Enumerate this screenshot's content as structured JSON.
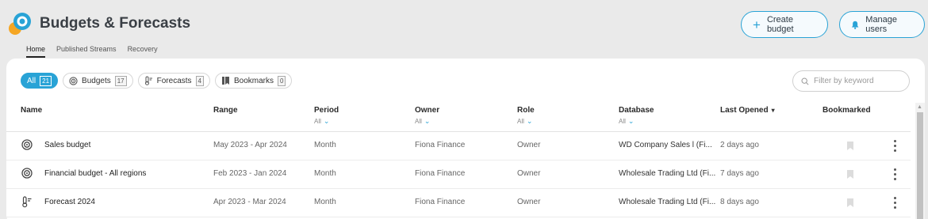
{
  "app": {
    "title": "Budgets & Forecasts"
  },
  "subnav": {
    "tabs": [
      "Home",
      "Published Streams",
      "Recovery"
    ],
    "active": "Home"
  },
  "header_buttons": {
    "create": "Create budget",
    "manage": "Manage users"
  },
  "filters": {
    "chips": [
      {
        "label": "All",
        "count": "21",
        "icon": "none",
        "active": true
      },
      {
        "label": "Budgets",
        "count": "17",
        "icon": "target-icon",
        "active": false
      },
      {
        "label": "Forecasts",
        "count": "4",
        "icon": "thermometer-icon",
        "active": false
      },
      {
        "label": "Bookmarks",
        "count": "0",
        "icon": "bookmark-icon",
        "active": false
      }
    ],
    "search_placeholder": "Filter by keyword"
  },
  "table": {
    "columns": {
      "name": "Name",
      "range": "Range",
      "period": {
        "label": "Period",
        "filter": "All"
      },
      "owner": {
        "label": "Owner",
        "filter": "All"
      },
      "role": {
        "label": "Role",
        "filter": "All"
      },
      "database": {
        "label": "Database",
        "filter": "All"
      },
      "last_opened": "Last Opened",
      "bookmarked": "Bookmarked"
    },
    "rows": [
      {
        "icon": "target-icon",
        "name": "Sales budget",
        "range": "May 2023 - Apr 2024",
        "period": "Month",
        "owner": "Fiona Finance",
        "role": "Owner",
        "database": "WD Company Sales  l (Fi...",
        "last_opened": "2 days ago"
      },
      {
        "icon": "target-icon",
        "name": "Financial budget - All regions",
        "range": "Feb 2023 - Jan 2024",
        "period": "Month",
        "owner": "Fiona Finance",
        "role": "Owner",
        "database": "Wholesale Trading Ltd (Fi...",
        "last_opened": "7 days ago"
      },
      {
        "icon": "thermometer-icon",
        "name": "Forecast 2024",
        "range": "Apr 2023 - Mar 2024",
        "period": "Month",
        "owner": "Fiona Finance",
        "role": "Owner",
        "database": "Wholesale Trading Ltd (Fi...",
        "last_opened": "8 days ago"
      }
    ]
  },
  "colors": {
    "accent": "#29a3d6",
    "logo_orange": "#f5a623",
    "logo_blue": "#29a3d6"
  }
}
